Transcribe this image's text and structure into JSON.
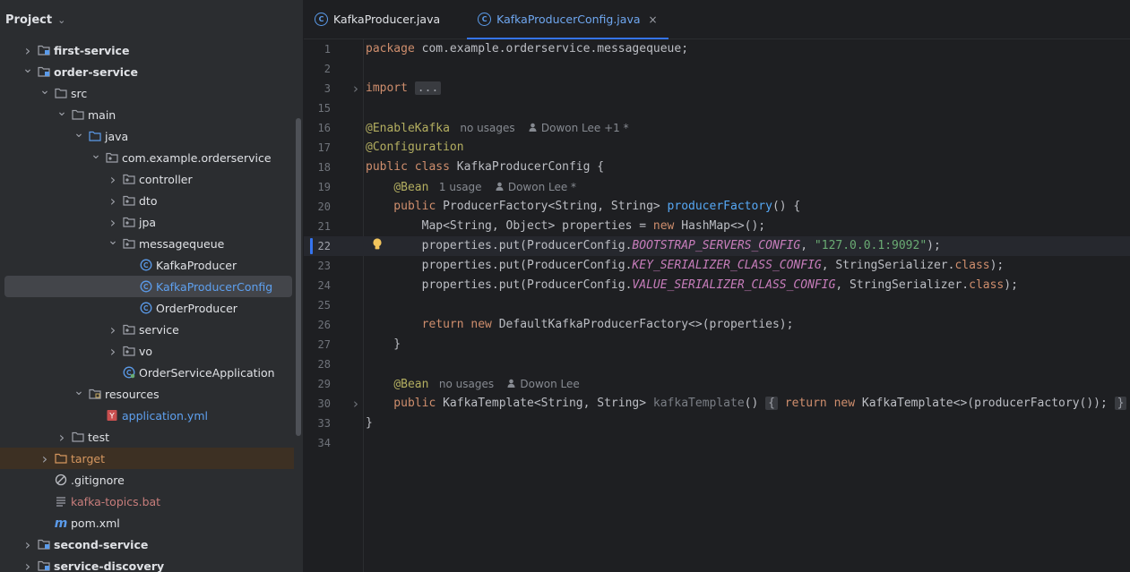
{
  "project_panel": {
    "title": "Project",
    "tree": [
      {
        "label": "first-service",
        "indent": 0,
        "icon": "module-folder-icon",
        "arrow": "collapsed",
        "style": "bold"
      },
      {
        "label": "order-service",
        "indent": 0,
        "icon": "module-folder-icon",
        "arrow": "expanded",
        "style": "bold"
      },
      {
        "label": "src",
        "indent": 1,
        "icon": "folder-icon",
        "arrow": "expanded",
        "style": ""
      },
      {
        "label": "main",
        "indent": 2,
        "icon": "folder-icon",
        "arrow": "expanded",
        "style": ""
      },
      {
        "label": "java",
        "indent": 3,
        "icon": "source-folder-icon",
        "arrow": "expanded",
        "style": ""
      },
      {
        "label": "com.example.orderservice",
        "indent": 4,
        "icon": "package-icon",
        "arrow": "expanded",
        "style": ""
      },
      {
        "label": "controller",
        "indent": 5,
        "icon": "package-icon",
        "arrow": "collapsed",
        "style": ""
      },
      {
        "label": "dto",
        "indent": 5,
        "icon": "package-icon",
        "arrow": "collapsed",
        "style": ""
      },
      {
        "label": "jpa",
        "indent": 5,
        "icon": "package-icon",
        "arrow": "collapsed",
        "style": ""
      },
      {
        "label": "messagequeue",
        "indent": 5,
        "icon": "package-icon",
        "arrow": "expanded",
        "style": ""
      },
      {
        "label": "KafkaProducer",
        "indent": 6,
        "icon": "class-icon",
        "arrow": "none",
        "style": ""
      },
      {
        "label": "KafkaProducerConfig",
        "indent": 6,
        "icon": "class-icon",
        "arrow": "none",
        "style": "blue",
        "selected": true
      },
      {
        "label": "OrderProducer",
        "indent": 6,
        "icon": "class-icon",
        "arrow": "none",
        "style": ""
      },
      {
        "label": "service",
        "indent": 5,
        "icon": "package-icon",
        "arrow": "collapsed",
        "style": ""
      },
      {
        "label": "vo",
        "indent": 5,
        "icon": "package-icon",
        "arrow": "collapsed",
        "style": ""
      },
      {
        "label": "OrderServiceApplication",
        "indent": 5,
        "icon": "spring-class-icon",
        "arrow": "none",
        "style": ""
      },
      {
        "label": "resources",
        "indent": 3,
        "icon": "resources-folder-icon",
        "arrow": "expanded",
        "style": ""
      },
      {
        "label": "application.yml",
        "indent": 4,
        "icon": "yaml-icon",
        "arrow": "none",
        "style": "blue"
      },
      {
        "label": "test",
        "indent": 2,
        "icon": "folder-icon",
        "arrow": "collapsed",
        "style": ""
      },
      {
        "label": "target",
        "indent": 1,
        "icon": "excluded-folder-icon",
        "arrow": "collapsed",
        "style": "orange",
        "excluded": true
      },
      {
        "label": ".gitignore",
        "indent": 1,
        "icon": "ignore-icon",
        "arrow": "none",
        "style": ""
      },
      {
        "label": "kafka-topics.bat",
        "indent": 1,
        "icon": "text-file-icon",
        "arrow": "none",
        "style": "red"
      },
      {
        "label": "pom.xml",
        "indent": 1,
        "icon": "maven-icon",
        "arrow": "none",
        "style": ""
      },
      {
        "label": "second-service",
        "indent": 0,
        "icon": "module-folder-icon",
        "arrow": "collapsed",
        "style": "bold"
      },
      {
        "label": "service-discovery",
        "indent": 0,
        "icon": "module-folder-icon",
        "arrow": "collapsed",
        "style": "bold"
      }
    ]
  },
  "tabs": [
    {
      "label": "KafkaProducer.java",
      "active": false
    },
    {
      "label": "KafkaProducerConfig.java",
      "active": true,
      "close": "×"
    }
  ],
  "editor": {
    "current_line": "22",
    "lines": [
      {
        "num": "1",
        "tokens": [
          [
            "kw",
            "package "
          ],
          [
            "pl",
            "com.example.orderservice.messagequeue;"
          ]
        ]
      },
      {
        "num": "2",
        "tokens": []
      },
      {
        "num": "3",
        "fold": true,
        "tokens": [
          [
            "kw",
            "import "
          ],
          [
            "box",
            "..."
          ]
        ]
      },
      {
        "num": "15",
        "tokens": []
      },
      {
        "num": "16",
        "tokens": [
          [
            "ann",
            "@EnableKafka"
          ]
        ],
        "hint": {
          "usages": "no usages",
          "author": "Dowon Lee +1 *"
        }
      },
      {
        "num": "17",
        "tokens": [
          [
            "ann",
            "@Configuration"
          ]
        ]
      },
      {
        "num": "18",
        "tokens": [
          [
            "kw",
            "public class "
          ],
          [
            "pl",
            "KafkaProducerConfig {"
          ]
        ]
      },
      {
        "num": "19",
        "tokens": [
          [
            "pl",
            "    "
          ],
          [
            "ann",
            "@Bean"
          ]
        ],
        "hint": {
          "usages": "1 usage",
          "author": "Dowon Lee *"
        }
      },
      {
        "num": "20",
        "tokens": [
          [
            "kw",
            "    public "
          ],
          [
            "pl",
            "ProducerFactory<String, String> "
          ],
          [
            "fn",
            "producerFactory"
          ],
          [
            "pl",
            "() {"
          ]
        ]
      },
      {
        "num": "21",
        "tokens": [
          [
            "pl",
            "        Map<String, Object> properties = "
          ],
          [
            "kw",
            "new "
          ],
          [
            "pl",
            "HashMap<>();"
          ]
        ]
      },
      {
        "num": "22",
        "bulb": true,
        "tokens": [
          [
            "pl",
            "        properties.put(ProducerConfig."
          ],
          [
            "fld",
            "BOOTSTRAP_SERVERS_CONFIG"
          ],
          [
            "pl",
            ", "
          ],
          [
            "str",
            "\"127.0.0.1:9092\""
          ],
          [
            "pl",
            ");"
          ]
        ]
      },
      {
        "num": "23",
        "tokens": [
          [
            "pl",
            "        properties.put(ProducerConfig."
          ],
          [
            "fld",
            "KEY_SERIALIZER_CLASS_CONFIG"
          ],
          [
            "pl",
            ", StringSerializer."
          ],
          [
            "kw",
            "class"
          ],
          [
            "pl",
            ");"
          ]
        ]
      },
      {
        "num": "24",
        "tokens": [
          [
            "pl",
            "        properties.put(ProducerConfig."
          ],
          [
            "fld",
            "VALUE_SERIALIZER_CLASS_CONFIG"
          ],
          [
            "pl",
            ", StringSerializer."
          ],
          [
            "kw",
            "class"
          ],
          [
            "pl",
            ");"
          ]
        ]
      },
      {
        "num": "25",
        "tokens": []
      },
      {
        "num": "26",
        "tokens": [
          [
            "kw",
            "        return new "
          ],
          [
            "pl",
            "DefaultKafkaProducerFactory<>(properties);"
          ]
        ]
      },
      {
        "num": "27",
        "tokens": [
          [
            "pl",
            "    }"
          ]
        ]
      },
      {
        "num": "28",
        "tokens": []
      },
      {
        "num": "29",
        "tokens": [
          [
            "pl",
            "    "
          ],
          [
            "ann",
            "@Bean"
          ]
        ],
        "hint": {
          "usages": "no usages",
          "author": "Dowon Lee"
        }
      },
      {
        "num": "30",
        "fold": true,
        "tokens": [
          [
            "kw",
            "    public "
          ],
          [
            "pl",
            "KafkaTemplate<String, String> "
          ],
          [
            "grey",
            "kafkaTemplate"
          ],
          [
            "pl",
            "() "
          ],
          [
            "box",
            "{"
          ],
          [
            "pl",
            " "
          ],
          [
            "kw",
            "return new "
          ],
          [
            "pl",
            "KafkaTemplate<>(producerFactory()); "
          ],
          [
            "box",
            "}"
          ]
        ]
      },
      {
        "num": "33",
        "tokens": [
          [
            "pl",
            "}"
          ]
        ]
      },
      {
        "num": "34",
        "tokens": []
      }
    ]
  }
}
